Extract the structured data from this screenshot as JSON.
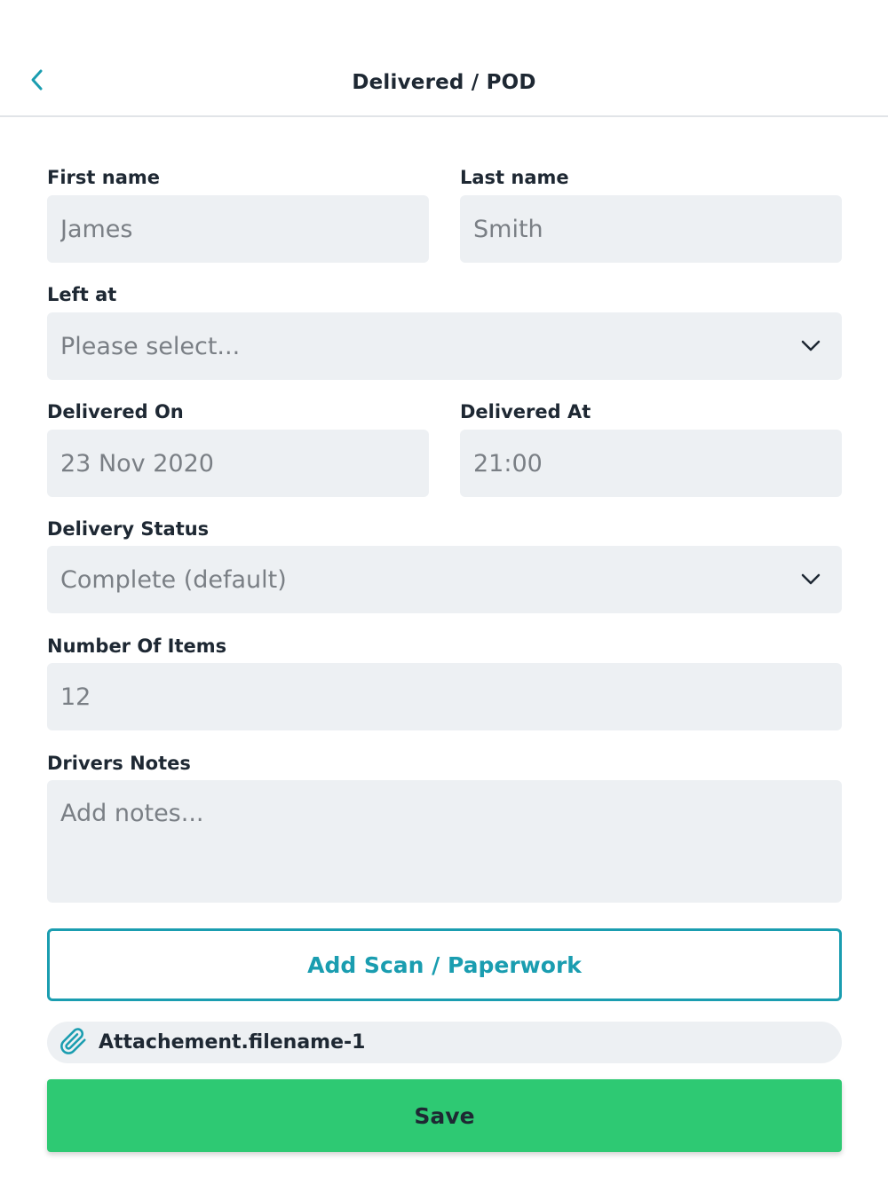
{
  "header": {
    "title": "Delivered / POD",
    "back_icon": "chevron-left-icon",
    "accent_color": "#1a9db0"
  },
  "form": {
    "first_name": {
      "label": "First name",
      "placeholder": "James"
    },
    "last_name": {
      "label": "Last name",
      "placeholder": "Smith"
    },
    "left_at": {
      "label": "Left at",
      "value": "Please select..."
    },
    "delivered_on": {
      "label": "Delivered On",
      "placeholder": "23 Nov 2020"
    },
    "delivered_at": {
      "label": "Delivered At",
      "placeholder": "21:00"
    },
    "delivery_status": {
      "label": "Delivery Status",
      "value": "Complete (default)"
    },
    "number_of_items": {
      "label": "Number Of Items",
      "placeholder": "12"
    },
    "drivers_notes": {
      "label": "Drivers Notes",
      "placeholder": "Add notes..."
    }
  },
  "actions": {
    "add_scan_label": "Add Scan / Paperwork",
    "attachment_name": "Attachement.filename-1",
    "attachment_icon": "paperclip-icon",
    "save_label": "Save",
    "save_color": "#2ec973"
  }
}
